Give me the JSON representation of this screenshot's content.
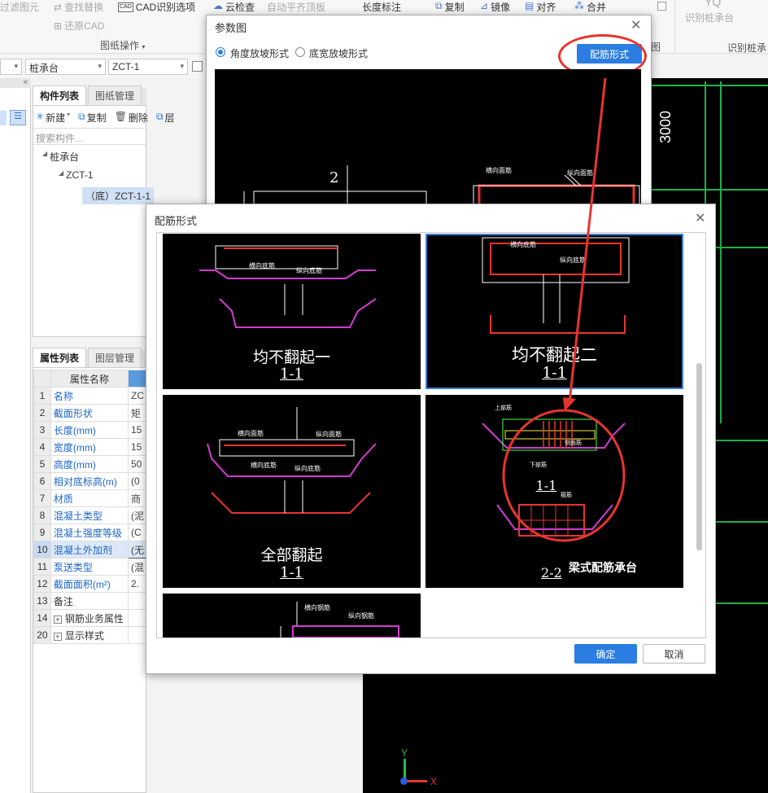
{
  "toolbar": {
    "filter_item": "过滤图元",
    "find_replace": "查找替换",
    "cad_options": "CAD识别选项",
    "restore_cad": "还原CAD",
    "group_label": "图纸操作",
    "cloud_check": "云检查",
    "auto_level": "自动平齐顶板",
    "length_dim": "长度标注",
    "copy": "复制",
    "mirror": "镜像",
    "align": "对齐",
    "merge": "合并",
    "identify_pile_cap": "识别桩承台",
    "group_right_a": "图",
    "group_right_b": "识别桩承"
  },
  "selectors": {
    "category": "桩承台",
    "component": "ZCT-1"
  },
  "component_panel": {
    "tabs": [
      "构件列表",
      "图纸管理"
    ],
    "actions": {
      "new": "新建",
      "copy": "复制",
      "delete": "删除",
      "layer": "层"
    },
    "search_placeholder": "搜索构件...",
    "tree": {
      "root": "桩承台",
      "child": "ZCT-1",
      "leaf": "（底）ZCT-1-1"
    }
  },
  "property_panel": {
    "tabs": [
      "属性列表",
      "图层管理"
    ],
    "header": "属性名称",
    "rows": [
      {
        "num": "1",
        "name": "名称",
        "val": "ZC",
        "link": true
      },
      {
        "num": "2",
        "name": "截面形状",
        "val": "矩",
        "link": true
      },
      {
        "num": "3",
        "name": "长度(mm)",
        "val": "15",
        "link": true
      },
      {
        "num": "4",
        "name": "宽度(mm)",
        "val": "15",
        "link": true
      },
      {
        "num": "5",
        "name": "高度(mm)",
        "val": "50",
        "link": true
      },
      {
        "num": "6",
        "name": "相对底标高(m)",
        "val": "(0",
        "link": true
      },
      {
        "num": "7",
        "name": "材质",
        "val": "商",
        "link": true
      },
      {
        "num": "8",
        "name": "混凝土类型",
        "val": "(泥",
        "link": true
      },
      {
        "num": "9",
        "name": "混凝土强度等级",
        "val": "(C",
        "link": true
      },
      {
        "num": "10",
        "name": "混凝土外加剂",
        "val": "(无",
        "link": true,
        "selected": true
      },
      {
        "num": "11",
        "name": "泵送类型",
        "val": "(混",
        "link": true
      },
      {
        "num": "12",
        "name": "截面面积(m²)",
        "val": "2.",
        "link": true
      },
      {
        "num": "13",
        "name": "备注",
        "val": "",
        "link": false
      },
      {
        "num": "14",
        "name": "钢筋业务属性",
        "val": "",
        "link": false,
        "expand": true
      },
      {
        "num": "20",
        "name": "显示样式",
        "val": "",
        "link": false,
        "expand": true
      }
    ]
  },
  "cad_canvas": {
    "dim_text": "3000",
    "axis_y": "Y",
    "axis_x": "X"
  },
  "param_dialog": {
    "title": "参数图",
    "radio_angle": "角度放坡形式",
    "radio_width": "底宽放坡形式",
    "rebar_button": "配筋形式",
    "drawing_number": "2"
  },
  "rebar_dialog": {
    "title": "配筋形式",
    "ok": "确定",
    "cancel": "取消",
    "tiles": [
      {
        "title": "均不翻起一",
        "sub": "1-1"
      },
      {
        "title": "均不翻起二",
        "sub": "1-1"
      },
      {
        "title": "全部翻起",
        "sub": "1-1"
      },
      {
        "title": "梁式配筋承台",
        "sub": "2-2",
        "sub_top": "1-1"
      }
    ],
    "annotations": {
      "horiz_top": "横向面筋",
      "vert_top": "纵向面筋",
      "horiz_bot": "横向底筋",
      "vert_bot": "纵向底筋",
      "top_rebar": "上部筋",
      "bottom_rebar": "下部筋",
      "side_rebar": "侧面筋",
      "stirrup": "箍筋",
      "horiz_rebar": "横向钢筋",
      "vert_rebar": "纵向钢筋",
      "code_mj": "MJ",
      "code_dj": "DJ",
      "code_xgj": "XGJ",
      "code_ygj": "YGJ"
    }
  },
  "colors": {
    "accent": "#2b7de1",
    "annotation_red": "#e8342f",
    "cad_bg": "#000000",
    "grid_green": "#1fb34b"
  }
}
